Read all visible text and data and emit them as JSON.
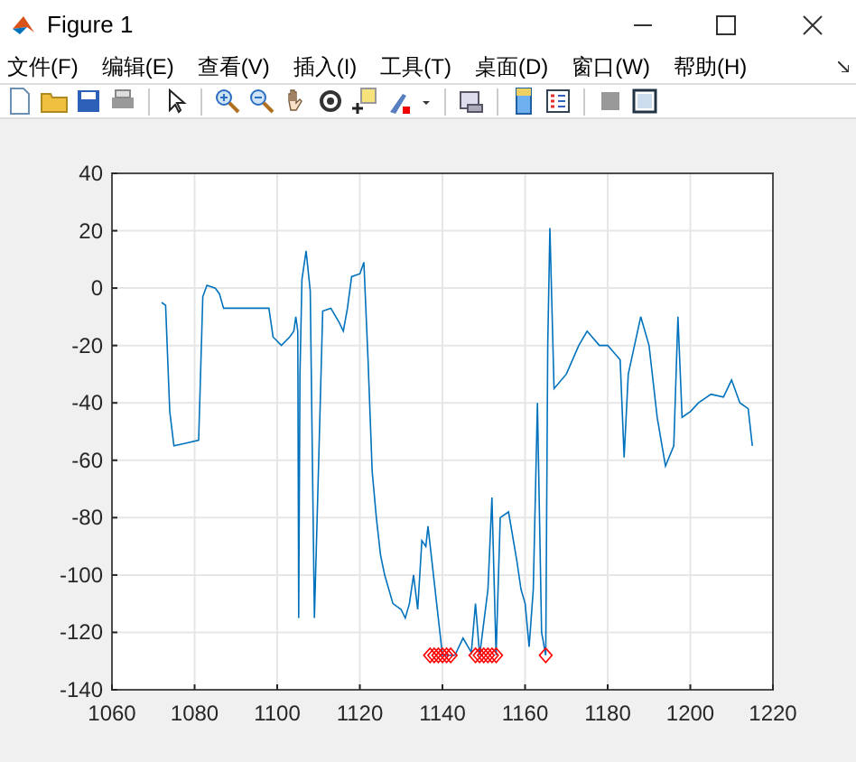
{
  "window": {
    "title": "Figure 1"
  },
  "menus": [
    "文件(F)",
    "编辑(E)",
    "查看(V)",
    "插入(I)",
    "工具(T)",
    "桌面(D)",
    "窗口(W)",
    "帮助(H)"
  ],
  "figure": {
    "chart_data": {
      "type": "line",
      "grid": true,
      "xlim": [
        1060,
        1220
      ],
      "ylim": [
        -140,
        40
      ],
      "xticks": [
        1060,
        1080,
        1100,
        1120,
        1140,
        1160,
        1180,
        1200,
        1220
      ],
      "yticks": [
        -140,
        -120,
        -100,
        -80,
        -60,
        -40,
        -20,
        0,
        20,
        40
      ],
      "series": [
        {
          "type": "line",
          "color": "#0072bd",
          "x": [
            1072,
            1073,
            1074,
            1075,
            1078,
            1081,
            1082,
            1083,
            1085,
            1086,
            1087,
            1094,
            1098,
            1099,
            1101,
            1103,
            1104,
            1104.5,
            1105,
            1105.2,
            1105.5,
            1106,
            1107,
            1108,
            1109,
            1110,
            1111,
            1113,
            1115,
            1116,
            1117,
            1118,
            1120,
            1121,
            1122,
            1123,
            1124,
            1125,
            1126,
            1128,
            1130,
            1131,
            1132,
            1133,
            1134,
            1135,
            1136,
            1136.5,
            1140,
            1143,
            1145,
            1147,
            1148,
            1149,
            1151,
            1152,
            1153,
            1154,
            1156,
            1158,
            1159,
            1160,
            1161,
            1162,
            1163,
            1164,
            1165,
            1165.5,
            1166,
            1167,
            1170,
            1173,
            1175,
            1178,
            1180,
            1183,
            1184,
            1185,
            1188,
            1190,
            1192,
            1194,
            1196,
            1197,
            1198,
            1200,
            1202,
            1205,
            1208,
            1210,
            1212,
            1214,
            1215
          ],
          "values": [
            -5,
            -6,
            -43,
            -55,
            -54,
            -53,
            -3,
            1,
            0,
            -2,
            -7,
            -7,
            -7,
            -17,
            -20,
            -17,
            -15,
            -10,
            -15,
            -115,
            -30,
            3,
            13,
            -1,
            -115,
            -62,
            -8,
            -7,
            -12,
            -15,
            -7,
            4,
            5,
            9,
            -25,
            -64,
            -80,
            -93,
            -100,
            -110,
            -112,
            -115,
            -110,
            -100,
            -112,
            -88,
            -90,
            -83,
            -128,
            -128,
            -122,
            -127,
            -110,
            -128,
            -105,
            -73,
            -128,
            -80,
            -78,
            -95,
            -105,
            -110,
            -125,
            -105,
            -40,
            -120,
            -128,
            -20,
            21,
            -35,
            -30,
            -20,
            -15,
            -20,
            -20,
            -25,
            -59,
            -30,
            -10,
            -20,
            -45,
            -62,
            -55,
            -10,
            -45,
            -43,
            -40,
            -37,
            -38,
            -32,
            -40,
            -42,
            -55
          ]
        },
        {
          "type": "scatter",
          "marker": "diamond",
          "color": "#ff0000",
          "x": [
            1137,
            1138,
            1139,
            1140,
            1141,
            1142,
            1148,
            1149,
            1150,
            1151,
            1152,
            1153,
            1165
          ],
          "values": [
            -128,
            -128,
            -128,
            -128,
            -128,
            -128,
            -128,
            -128,
            -128,
            -128,
            -128,
            -128,
            -128
          ]
        }
      ]
    }
  }
}
